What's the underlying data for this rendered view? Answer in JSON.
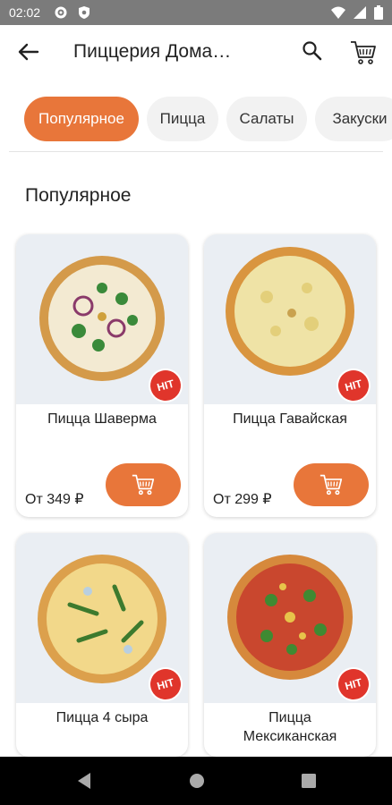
{
  "status_bar": {
    "time": "02:02"
  },
  "app_bar": {
    "title": "Пиццерия Дома…"
  },
  "categories": [
    "Популярное",
    "Пицца",
    "Салаты",
    "Закуски"
  ],
  "section_title": "Популярное",
  "products": [
    {
      "name": "Пицца Шаверма",
      "price": "От 349 ₽",
      "badge": "HIT"
    },
    {
      "name": "Пицца Гавайская",
      "price": "От 299 ₽",
      "badge": "HIT"
    },
    {
      "name": "Пицца 4 сыра",
      "price": "",
      "badge": "HIT"
    },
    {
      "name": "Пицца Мексиканская",
      "price": "",
      "badge": "HIT"
    }
  ],
  "colors": {
    "accent": "#e8763a",
    "badge": "#e0352b",
    "status_bar": "#7b7b7b"
  }
}
